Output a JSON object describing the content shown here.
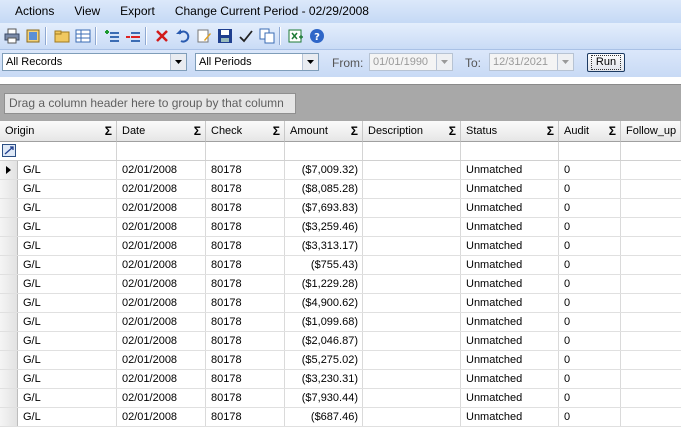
{
  "menu": [
    "Actions",
    "View",
    "Export",
    "Change Current Period - 02/29/2008"
  ],
  "toolbar_icons": [
    "print-icon",
    "preview-icon",
    "folder-icon",
    "grid-icon",
    "add-row-icon",
    "remove-row-icon",
    "delete-icon",
    "undo-icon",
    "edit-icon",
    "save-icon",
    "checkmark-icon",
    "copy-icon",
    "excel-export-icon",
    "help-icon"
  ],
  "filters": {
    "records": "All Records",
    "periods": "All Periods",
    "from_label": "From:",
    "from_date": "01/01/1990",
    "to_label": "To:",
    "to_date": "12/31/2021",
    "run_label": "Run"
  },
  "group_hint": "Drag a column header here to group by that column",
  "columns": [
    "Origin",
    "Date",
    "Check",
    "Amount",
    "Description",
    "Status",
    "Audit",
    "Follow_up"
  ],
  "sum_symbol": "Σ",
  "rows": [
    {
      "origin": "G/L",
      "date": "02/01/2008",
      "check": "80178",
      "amount": "($7,009.32)",
      "description": "",
      "status": "Unmatched",
      "audit": "0"
    },
    {
      "origin": "G/L",
      "date": "02/01/2008",
      "check": "80178",
      "amount": "($8,085.28)",
      "description": "",
      "status": "Unmatched",
      "audit": "0"
    },
    {
      "origin": "G/L",
      "date": "02/01/2008",
      "check": "80178",
      "amount": "($7,693.83)",
      "description": "",
      "status": "Unmatched",
      "audit": "0"
    },
    {
      "origin": "G/L",
      "date": "02/01/2008",
      "check": "80178",
      "amount": "($3,259.46)",
      "description": "",
      "status": "Unmatched",
      "audit": "0"
    },
    {
      "origin": "G/L",
      "date": "02/01/2008",
      "check": "80178",
      "amount": "($3,313.17)",
      "description": "",
      "status": "Unmatched",
      "audit": "0"
    },
    {
      "origin": "G/L",
      "date": "02/01/2008",
      "check": "80178",
      "amount": "($755.43)",
      "description": "",
      "status": "Unmatched",
      "audit": "0"
    },
    {
      "origin": "G/L",
      "date": "02/01/2008",
      "check": "80178",
      "amount": "($1,229.28)",
      "description": "",
      "status": "Unmatched",
      "audit": "0"
    },
    {
      "origin": "G/L",
      "date": "02/01/2008",
      "check": "80178",
      "amount": "($4,900.62)",
      "description": "",
      "status": "Unmatched",
      "audit": "0"
    },
    {
      "origin": "G/L",
      "date": "02/01/2008",
      "check": "80178",
      "amount": "($1,099.68)",
      "description": "",
      "status": "Unmatched",
      "audit": "0"
    },
    {
      "origin": "G/L",
      "date": "02/01/2008",
      "check": "80178",
      "amount": "($2,046.87)",
      "description": "",
      "status": "Unmatched",
      "audit": "0"
    },
    {
      "origin": "G/L",
      "date": "02/01/2008",
      "check": "80178",
      "amount": "($5,275.02)",
      "description": "",
      "status": "Unmatched",
      "audit": "0"
    },
    {
      "origin": "G/L",
      "date": "02/01/2008",
      "check": "80178",
      "amount": "($3,230.31)",
      "description": "",
      "status": "Unmatched",
      "audit": "0"
    },
    {
      "origin": "G/L",
      "date": "02/01/2008",
      "check": "80178",
      "amount": "($7,930.44)",
      "description": "",
      "status": "Unmatched",
      "audit": "0"
    },
    {
      "origin": "G/L",
      "date": "02/01/2008",
      "check": "80178",
      "amount": "($687.46)",
      "description": "",
      "status": "Unmatched",
      "audit": "0"
    }
  ]
}
